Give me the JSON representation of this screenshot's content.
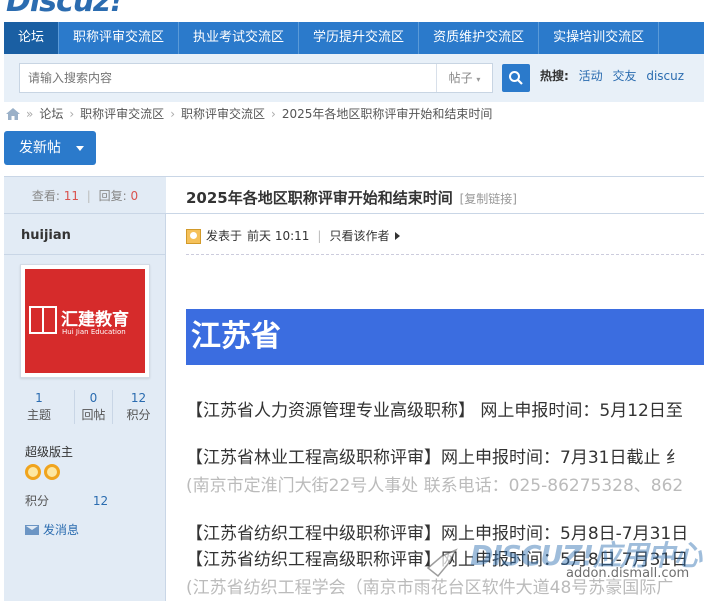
{
  "site": {
    "logo": "Discuz!"
  },
  "nav": {
    "items": [
      {
        "label": "论坛",
        "active": true
      },
      {
        "label": "职称评审交流区"
      },
      {
        "label": "执业考试交流区"
      },
      {
        "label": "学历提升交流区"
      },
      {
        "label": "资质维护交流区"
      },
      {
        "label": "实操培训交流区"
      }
    ]
  },
  "search": {
    "placeholder": "请输入搜索内容",
    "type": "帖子",
    "hot_label": "热搜:",
    "hot_items": [
      "活动",
      "交友",
      "discuz"
    ]
  },
  "breadcrumb": [
    "论坛",
    "职称评审交流区",
    "职称评审交流区",
    "2025年各地区职称评审开始和结束时间"
  ],
  "post_button": {
    "label": "发新帖"
  },
  "thread": {
    "views_label": "查看:",
    "views": "11",
    "replies_label": "回复:",
    "replies": "0",
    "title": "2025年各地区职称评审开始和结束时间",
    "copy_link": "[复制链接]"
  },
  "author": {
    "name": "huijian",
    "avatar_cn": "汇建教育",
    "avatar_en": "Hui Jian Education",
    "stats": [
      {
        "value": "1",
        "label": "主题"
      },
      {
        "value": "0",
        "label": "回帖"
      },
      {
        "value": "12",
        "label": "积分"
      }
    ],
    "rank": "超级版主",
    "points_label": "积分",
    "points_value": "12",
    "message_label": "发消息"
  },
  "post": {
    "posted_label": "发表于",
    "posted_time": "前天 10:11",
    "author_only": "只看该作者",
    "province": "江苏省",
    "lines": [
      "【江苏省人力资源管理专业高级职称】 网上申报时间：5月12日至",
      "【江苏省林业工程高级职称评审】网上申报时间：7月31日截止  纟",
      "(南京市定淮门大街22号人事处  联系电话：025-86275328、862",
      "【江苏省纺织工程中级职称评审】网上申报时间：5月8日-7月31日",
      "【江苏省纺织工程高级职称评审】网上申报时间：5月8日-7月31日",
      "(江苏省纺织工程学会（南京市雨花台区软件大道48号苏豪国际广"
    ]
  },
  "watermark": {
    "brand": "DISCUZ!应用中心",
    "domain": "addon.dismall.com"
  },
  "colors": {
    "primary": "#2b7acb",
    "province_bg": "#3b6de0",
    "sidebar_bg": "#e2ebf5",
    "highlight": "#d9534f"
  }
}
